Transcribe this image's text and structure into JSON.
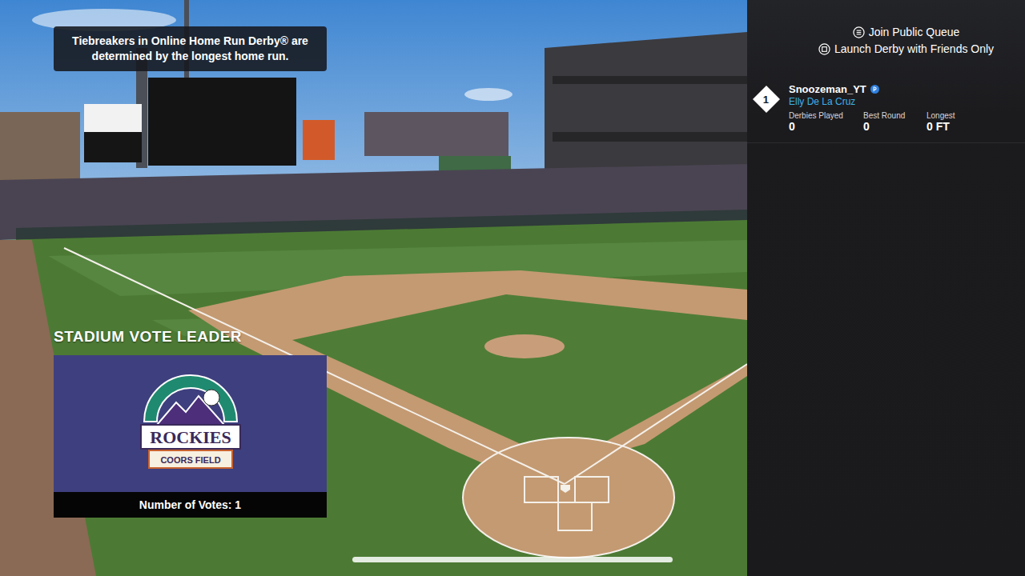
{
  "tooltip": {
    "text": "Tiebreakers in Online Home Run Derby® are determined by the longest home run."
  },
  "vote_leader": {
    "heading": "STADIUM VOTE LEADER",
    "logo": {
      "team": "ROCKIES",
      "stadium": "COORS FIELD"
    },
    "votes": "Number of Votes: 1"
  },
  "actions": [
    {
      "label": "Join Public Queue",
      "kind": "menu"
    },
    {
      "label": "Launch Derby with Friends Only",
      "kind": "square"
    }
  ],
  "players": [
    {
      "rank": "1",
      "name": "Snoozeman_YT",
      "card": "Elly De La Cruz",
      "stats": [
        {
          "label": "Derbies Played",
          "value": "0"
        },
        {
          "label": "Best Round",
          "value": "0"
        },
        {
          "label": "Longest",
          "value": "0 FT"
        }
      ]
    }
  ]
}
